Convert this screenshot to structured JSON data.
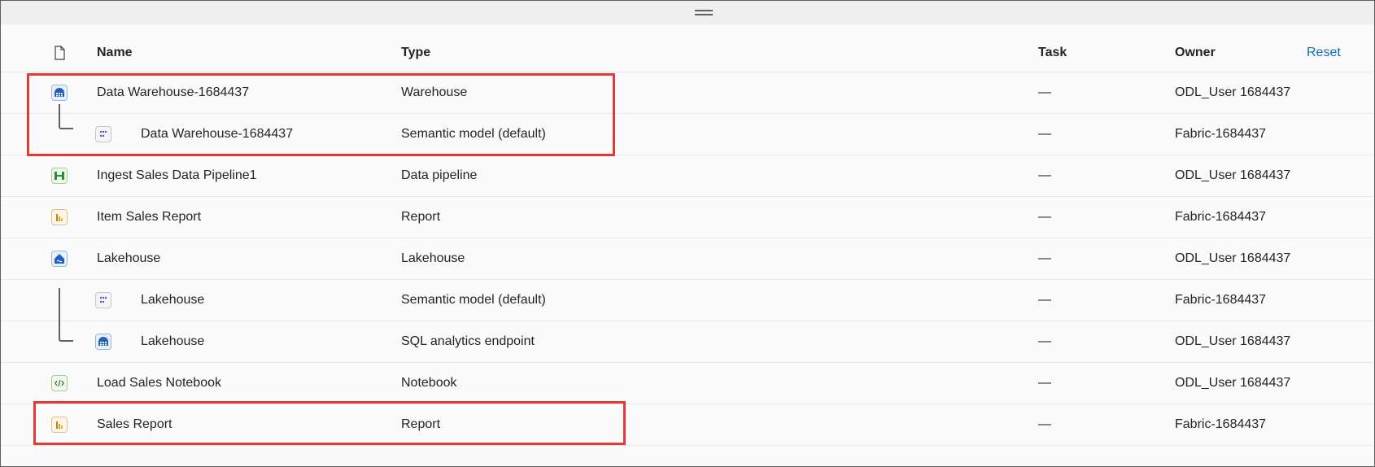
{
  "header": {
    "name_label": "Name",
    "type_label": "Type",
    "task_label": "Task",
    "owner_label": "Owner",
    "reset_label": "Reset"
  },
  "rows": [
    {
      "name": "Data Warehouse-1684437",
      "type": "Warehouse",
      "task": "—",
      "owner": "ODL_User 1684437",
      "icon": "warehouse-icon"
    },
    {
      "name": "Data Warehouse-1684437",
      "type": "Semantic model (default)",
      "task": "—",
      "owner": "Fabric-1684437",
      "icon": "semantic-model-icon"
    },
    {
      "name": "Ingest Sales Data Pipeline1",
      "type": "Data pipeline",
      "task": "—",
      "owner": "ODL_User 1684437",
      "icon": "pipeline-icon"
    },
    {
      "name": "Item Sales Report",
      "type": "Report",
      "task": "—",
      "owner": "Fabric-1684437",
      "icon": "report-icon"
    },
    {
      "name": "Lakehouse",
      "type": "Lakehouse",
      "task": "—",
      "owner": "ODL_User 1684437",
      "icon": "lakehouse-icon"
    },
    {
      "name": "Lakehouse",
      "type": "Semantic model (default)",
      "task": "—",
      "owner": "Fabric-1684437",
      "icon": "semantic-model-icon"
    },
    {
      "name": "Lakehouse",
      "type": "SQL analytics endpoint",
      "task": "—",
      "owner": "ODL_User 1684437",
      "icon": "sql-endpoint-icon"
    },
    {
      "name": "Load Sales Notebook",
      "type": "Notebook",
      "task": "—",
      "owner": "ODL_User 1684437",
      "icon": "notebook-icon"
    },
    {
      "name": "Sales Report",
      "type": "Report",
      "task": "—",
      "owner": "Fabric-1684437",
      "icon": "report-icon"
    }
  ]
}
